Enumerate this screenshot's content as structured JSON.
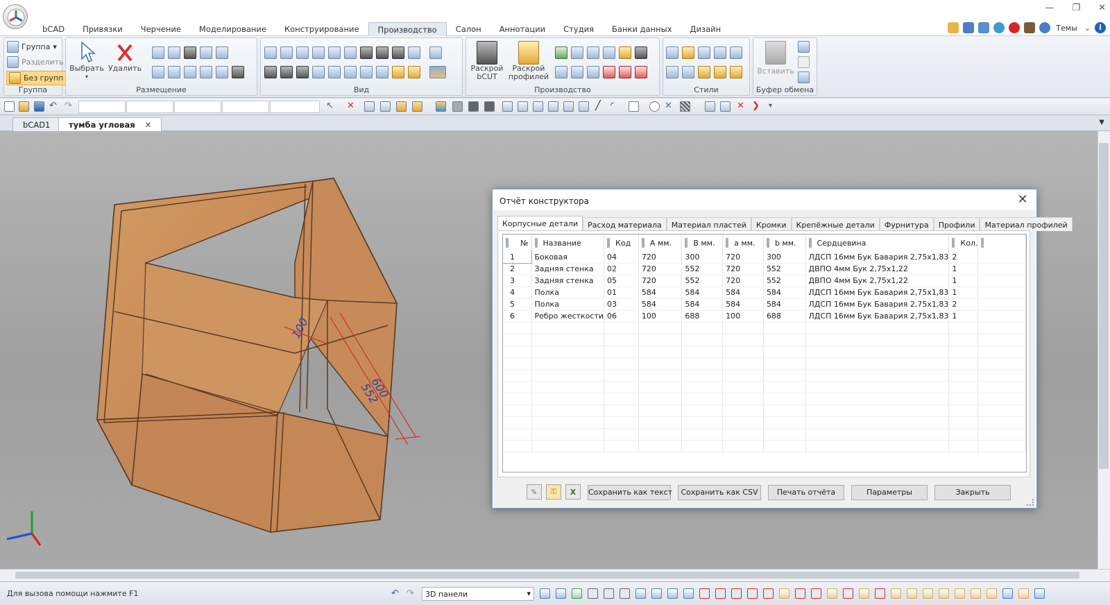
{
  "menu": {
    "tabs": [
      "bCAD",
      "Привязки",
      "Черчение",
      "Моделирование",
      "Конструирование",
      "Производство",
      "Салон",
      "Аннотации",
      "Студия",
      "Банки данных",
      "Дизайн"
    ],
    "active_tab": "Производство",
    "themes_label": "Темы"
  },
  "ribbon": {
    "group_group": {
      "label": "Группа",
      "group_btn": "Группа",
      "split_btn": "Разделить",
      "nogroup_btn": "Без групп"
    },
    "placement": {
      "label": "Размещение",
      "select_btn": "Выбрать",
      "delete_btn": "Удалить"
    },
    "view": {
      "label": "Вид"
    },
    "production": {
      "label": "Производство",
      "bcut_btn": "Раскрой bCUT",
      "profiles_btn": "Раскрой профилей"
    },
    "styles": {
      "label": "Стили"
    },
    "clipboard": {
      "label": "Буфер обмена",
      "paste_btn": "Вставить"
    }
  },
  "doc_tabs": [
    {
      "label": "bCAD1",
      "active": false
    },
    {
      "label": "тумба угловая",
      "active": true
    }
  ],
  "viewport": {
    "dim_labels": [
      "100",
      "600",
      "552"
    ]
  },
  "dialog": {
    "title": "Отчёт конструктора",
    "tabs": [
      "Корпусные детали",
      "Расход материала",
      "Материал пластей",
      "Кромки",
      "Крепёжные детали",
      "Фурнитура",
      "Профили",
      "Материал профилей"
    ],
    "active_tab": "Корпусные детали",
    "columns": [
      "№",
      "Название",
      "Код",
      "А мм.",
      "В мм.",
      "а мм.",
      "b мм.",
      "Сердцевина",
      "Кол."
    ],
    "rows": [
      [
        "1",
        "Боковая",
        "04",
        "720",
        "300",
        "720",
        "300",
        "ЛДСП 16мм Бук Бавария 2,75х1,83",
        "2"
      ],
      [
        "2",
        "Задняя стенка",
        "02",
        "720",
        "552",
        "720",
        "552",
        "ДВПО 4мм Бук 2,75х1,22",
        "1"
      ],
      [
        "3",
        "Задняя стенка",
        "05",
        "720",
        "552",
        "720",
        "552",
        "ДВПО 4мм Бук 2,75х1,22",
        "1"
      ],
      [
        "4",
        "Полка",
        "01",
        "584",
        "584",
        "584",
        "584",
        "ЛДСП 16мм Бук Бавария 2,75х1,83",
        "1"
      ],
      [
        "5",
        "Полка",
        "03",
        "584",
        "584",
        "584",
        "584",
        "ЛДСП 16мм Бук Бавария 2,75х1,83",
        "2"
      ],
      [
        "6",
        "Ребро жесткости",
        "06",
        "100",
        "688",
        "100",
        "688",
        "ЛДСП 16мм Бук Бавария 2,75х1,83",
        "1"
      ]
    ],
    "buttons": {
      "save_text": "Сохранить как текст",
      "save_csv": "Сохранить как CSV",
      "print": "Печать отчёта",
      "params": "Параметры",
      "close": "Закрыть"
    }
  },
  "status": {
    "help_text": "Для вызова помощи нажмите F1",
    "mode_select": "3D панели"
  }
}
